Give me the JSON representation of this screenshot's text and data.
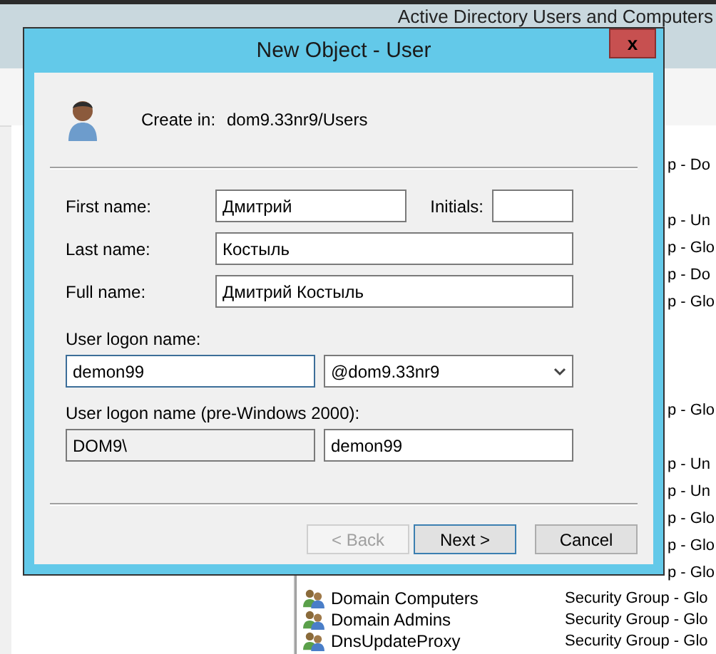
{
  "main_window": {
    "title": "Active Directory Users and Computers",
    "list_fragments": [
      "p - Do",
      "p - Un",
      "p - Glo",
      "p - Do",
      "p - Glo",
      "p - Glo",
      "p - Un",
      "p - Un",
      "p - Glo",
      "p - Glo",
      "p - Glo"
    ],
    "list_rows": [
      {
        "name": "Domain Computers",
        "type": "Security Group - Glo"
      },
      {
        "name": "Domain Admins",
        "type": "Security Group - Glo"
      },
      {
        "name": "DnsUpdateProxy",
        "type": "Security Group - Glo"
      }
    ]
  },
  "dialog": {
    "title": "New Object - User",
    "close": "x",
    "create_in_label": "Create in:",
    "create_in_path": "dom9.33nr9/Users",
    "first_name": {
      "label": "First name:",
      "value": "Дмитрий"
    },
    "initials": {
      "label": "Initials:"
    },
    "last_name": {
      "label": "Last name:",
      "value": "Костыль"
    },
    "full_name": {
      "label": "Full name:",
      "value": "Дмитрий Костыль"
    },
    "logon": {
      "label": "User logon name:",
      "value": "demon99",
      "domain": "@dom9.33nr9"
    },
    "pre2000": {
      "label": "User logon name (pre-Windows 2000):",
      "domain": "DOM9\\",
      "value": "demon99"
    },
    "buttons": [
      {
        "label": "< Back",
        "disabled": true,
        "default": false
      },
      {
        "label": "Next >",
        "disabled": false,
        "default": true
      },
      {
        "label": "Cancel",
        "disabled": false,
        "default": false
      }
    ]
  }
}
